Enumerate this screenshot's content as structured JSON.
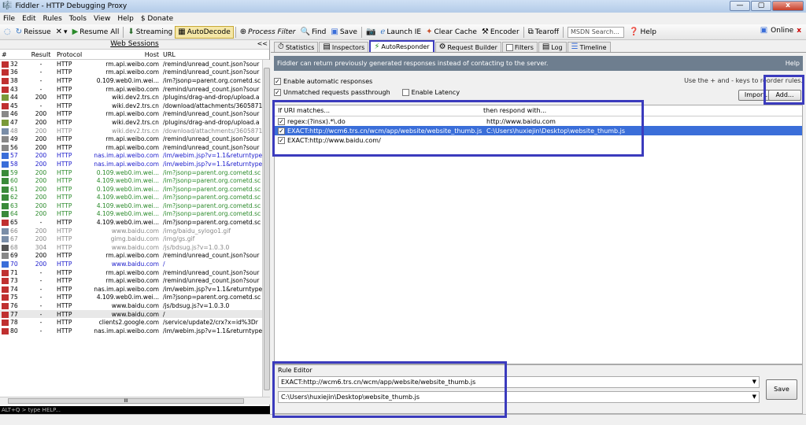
{
  "window": {
    "title": "Fiddler - HTTP Debugging Proxy",
    "buttons": [
      "—",
      "▢",
      "x"
    ]
  },
  "menu": [
    "File",
    "Edit",
    "Rules",
    "Tools",
    "View",
    "Help",
    "$ Donate"
  ],
  "toolbar": {
    "items": [
      {
        "icon": "replay-icon",
        "label": "Reissue"
      },
      {
        "icon": "remove-icon",
        "label": "▾"
      },
      {
        "icon": "resume-icon",
        "label": "Resume All"
      },
      {
        "icon": "streaming-icon",
        "label": "Streaming"
      },
      {
        "icon": "autodecode-icon",
        "label": "AutoDecode"
      },
      {
        "icon": "target-icon",
        "label": "Process Filter"
      },
      {
        "icon": "find-icon",
        "label": "Find"
      },
      {
        "icon": "save-icon",
        "label": "Save"
      },
      {
        "icon": "camera-icon",
        "label": ""
      },
      {
        "icon": "ie-icon",
        "label": "Launch IE"
      },
      {
        "icon": "clear-cache-icon",
        "label": "Clear Cache"
      },
      {
        "icon": "encoder-icon",
        "label": "Encoder"
      },
      {
        "icon": "tearoff-icon",
        "label": "Tearoff"
      }
    ],
    "search_placeholder": "MSDN Search...",
    "help": "Help",
    "online": "Online",
    "close_x": "x"
  },
  "sessions": {
    "header": "Web Sessions",
    "collapse": "<<",
    "columns": [
      "#",
      "Result",
      "Protocol",
      "Host",
      "URL"
    ],
    "rows": [
      {
        "id": "32",
        "result": "-",
        "protocol": "HTTP",
        "host": "rm.api.weibo.com",
        "url": "/remind/unread_count.json?sour",
        "color": "#000",
        "icon": "#c03030"
      },
      {
        "id": "36",
        "result": "-",
        "protocol": "HTTP",
        "host": "rm.api.weibo.com",
        "url": "/remind/unread_count.json?sour",
        "color": "#000",
        "icon": "#c03030"
      },
      {
        "id": "38",
        "result": "-",
        "protocol": "HTTP",
        "host": "0.109.web0.im.wei...",
        "url": "/im?jsonp=parent.org.cometd.sc",
        "color": "#000",
        "icon": "#c03030"
      },
      {
        "id": "43",
        "result": "-",
        "protocol": "HTTP",
        "host": "rm.api.weibo.com",
        "url": "/remind/unread_count.json?sour",
        "color": "#000",
        "icon": "#c03030"
      },
      {
        "id": "44",
        "result": "200",
        "protocol": "HTTP",
        "host": "wiki.dev2.trs.cn",
        "url": "/plugins/drag-and-drop/upload.a",
        "color": "#000",
        "icon": "#7a9a3a"
      },
      {
        "id": "45",
        "result": "-",
        "protocol": "HTTP",
        "host": "wiki.dev2.trs.cn",
        "url": "/download/attachments/3605871",
        "color": "#000",
        "icon": "#c03030"
      },
      {
        "id": "46",
        "result": "200",
        "protocol": "HTTP",
        "host": "rm.api.weibo.com",
        "url": "/remind/unread_count.json?sour",
        "color": "#000",
        "icon": "#888"
      },
      {
        "id": "47",
        "result": "200",
        "protocol": "HTTP",
        "host": "wiki.dev2.trs.cn",
        "url": "/plugins/drag-and-drop/upload.a",
        "color": "#000",
        "icon": "#7a9a3a"
      },
      {
        "id": "48",
        "result": "200",
        "protocol": "HTTP",
        "host": "wiki.dev2.trs.cn",
        "url": "/download/attachments/3605871",
        "color": "#888",
        "icon": "#7a8ea8"
      },
      {
        "id": "49",
        "result": "200",
        "protocol": "HTTP",
        "host": "rm.api.weibo.com",
        "url": "/remind/unread_count.json?sour",
        "color": "#000",
        "icon": "#888"
      },
      {
        "id": "56",
        "result": "200",
        "protocol": "HTTP",
        "host": "rm.api.weibo.com",
        "url": "/remind/unread_count.json?sour",
        "color": "#000",
        "icon": "#888"
      },
      {
        "id": "57",
        "result": "200",
        "protocol": "HTTP",
        "host": "nas.im.api.weibo.com",
        "url": "/im/webim.jsp?v=1.1&returntype",
        "color": "#1a1acc",
        "icon": "#3a6ed9"
      },
      {
        "id": "58",
        "result": "200",
        "protocol": "HTTP",
        "host": "nas.im.api.weibo.com",
        "url": "/im/webim.jsp?v=1.1&returntype",
        "color": "#1a1acc",
        "icon": "#3a6ed9"
      },
      {
        "id": "59",
        "result": "200",
        "protocol": "HTTP",
        "host": "0.109.web0.im.wei...",
        "url": "/im?jsonp=parent.org.cometd.sc",
        "color": "#2a8a2a",
        "icon": "#3a8a3a"
      },
      {
        "id": "60",
        "result": "200",
        "protocol": "HTTP",
        "host": "4.109.web0.im.wei...",
        "url": "/im?jsonp=parent.org.cometd.sc",
        "color": "#2a8a2a",
        "icon": "#3a8a3a"
      },
      {
        "id": "61",
        "result": "200",
        "protocol": "HTTP",
        "host": "0.109.web0.im.wei...",
        "url": "/im?jsonp=parent.org.cometd.sc",
        "color": "#2a8a2a",
        "icon": "#3a8a3a"
      },
      {
        "id": "62",
        "result": "200",
        "protocol": "HTTP",
        "host": "4.109.web0.im.wei...",
        "url": "/im?jsonp=parent.org.cometd.sc",
        "color": "#2a8a2a",
        "icon": "#3a8a3a"
      },
      {
        "id": "63",
        "result": "200",
        "protocol": "HTTP",
        "host": "4.109.web0.im.wei...",
        "url": "/im?jsonp=parent.org.cometd.sc",
        "color": "#2a8a2a",
        "icon": "#3a8a3a"
      },
      {
        "id": "64",
        "result": "200",
        "protocol": "HTTP",
        "host": "4.109.web0.im.wei...",
        "url": "/im?jsonp=parent.org.cometd.sc",
        "color": "#2a8a2a",
        "icon": "#3a8a3a"
      },
      {
        "id": "65",
        "result": "-",
        "protocol": "HTTP",
        "host": "4.109.web0.im.wei...",
        "url": "/im?jsonp=parent.org.cometd.sc",
        "color": "#000",
        "icon": "#c03030"
      },
      {
        "id": "66",
        "result": "200",
        "protocol": "HTTP",
        "host": "www.baidu.com",
        "url": "/img/baidu_sylogo1.gif",
        "color": "#888",
        "icon": "#7a8ea8"
      },
      {
        "id": "67",
        "result": "200",
        "protocol": "HTTP",
        "host": "gimg.baidu.com",
        "url": "/img/gs.gif",
        "color": "#888",
        "icon": "#7a8ea8"
      },
      {
        "id": "68",
        "result": "304",
        "protocol": "HTTP",
        "host": "www.baidu.com",
        "url": "/js/bdsug.js?v=1.0.3.0",
        "color": "#888",
        "icon": "#555"
      },
      {
        "id": "69",
        "result": "200",
        "protocol": "HTTP",
        "host": "rm.api.weibo.com",
        "url": "/remind/unread_count.json?sour",
        "color": "#000",
        "icon": "#888"
      },
      {
        "id": "70",
        "result": "200",
        "protocol": "HTTP",
        "host": "www.baidu.com",
        "url": "/",
        "color": "#1a1acc",
        "icon": "#3a6ed9"
      },
      {
        "id": "71",
        "result": "-",
        "protocol": "HTTP",
        "host": "rm.api.weibo.com",
        "url": "/remind/unread_count.json?sour",
        "color": "#000",
        "icon": "#c03030"
      },
      {
        "id": "73",
        "result": "-",
        "protocol": "HTTP",
        "host": "rm.api.weibo.com",
        "url": "/remind/unread_count.json?sour",
        "color": "#000",
        "icon": "#c03030"
      },
      {
        "id": "74",
        "result": "-",
        "protocol": "HTTP",
        "host": "nas.im.api.weibo.com",
        "url": "/im/webim.jsp?v=1.1&returntype",
        "color": "#000",
        "icon": "#c03030"
      },
      {
        "id": "75",
        "result": "-",
        "protocol": "HTTP",
        "host": "4.109.web0.im.wei...",
        "url": "/im?jsonp=parent.org.cometd.sc",
        "color": "#000",
        "icon": "#c03030"
      },
      {
        "id": "76",
        "result": "-",
        "protocol": "HTTP",
        "host": "www.baidu.com",
        "url": "/js/bdsug.js?v=1.0.3.0",
        "color": "#000",
        "icon": "#c03030"
      },
      {
        "id": "77",
        "result": "-",
        "protocol": "HTTP",
        "host": "www.baidu.com",
        "url": "/",
        "color": "#000",
        "icon": "#c03030",
        "selected": true
      },
      {
        "id": "78",
        "result": "-",
        "protocol": "HTTP",
        "host": "clients2.google.com",
        "url": "/service/update2/crx?x=id%3Dr",
        "color": "#000",
        "icon": "#c03030"
      },
      {
        "id": "80",
        "result": "-",
        "protocol": "HTTP",
        "host": "nas.im.api.weibo.com",
        "url": "/im/webim.jsp?v=1.1&returntype",
        "color": "#000",
        "icon": "#c03030"
      }
    ],
    "hscroll_label": "III",
    "quickexec": "ALT+Q > type HELP..."
  },
  "tabs": [
    {
      "icon": "stopwatch-icon",
      "label": "Statistics"
    },
    {
      "icon": "inspect-icon",
      "label": "Inspectors"
    },
    {
      "icon": "bolt-icon",
      "label": "AutoResponder",
      "active": true
    },
    {
      "icon": "builder-icon",
      "label": "Request Builder"
    },
    {
      "icon": "filter-icon",
      "label": "Filters"
    },
    {
      "icon": "log-icon",
      "label": "Log"
    },
    {
      "icon": "timeline-icon",
      "label": "Timeline"
    }
  ],
  "autoresponder": {
    "info": "Fiddler can return previously generated responses instead of contacting to the server.",
    "help": "Help",
    "enable_label": "Enable automatic responses",
    "passthrough_label": "Unmatched requests passthrough",
    "latency_label": "Enable Latency",
    "hint": "Use the + and - keys to reorder rules.",
    "import": "Import...",
    "add": "Add...",
    "col_match": "If URI matches...",
    "col_respond": "then respond with...",
    "rules": [
      {
        "match": "regex:(?insx).*\\.do",
        "respond": "http://www.baidu.com"
      },
      {
        "match": "EXACT:http://wcm6.trs.cn/wcm/app/website/website_thumb.js",
        "respond": "C:\\Users\\huxiejin\\Desktop\\website_thumb.js",
        "selected": true
      },
      {
        "match": "EXACT:http://www.baidu.com/",
        "respond": ""
      }
    ],
    "editor_label": "Rule Editor",
    "editor_match": "EXACT:http://wcm6.trs.cn/wcm/app/website/website_thumb.js",
    "editor_respond": "C:\\Users\\huxiejin\\Desktop\\website_thumb.js",
    "save": "Save"
  },
  "colors": {
    "highlight": "#3b3bbd",
    "selection": "#3a6ed9",
    "infobar": "#6e7e8f"
  }
}
